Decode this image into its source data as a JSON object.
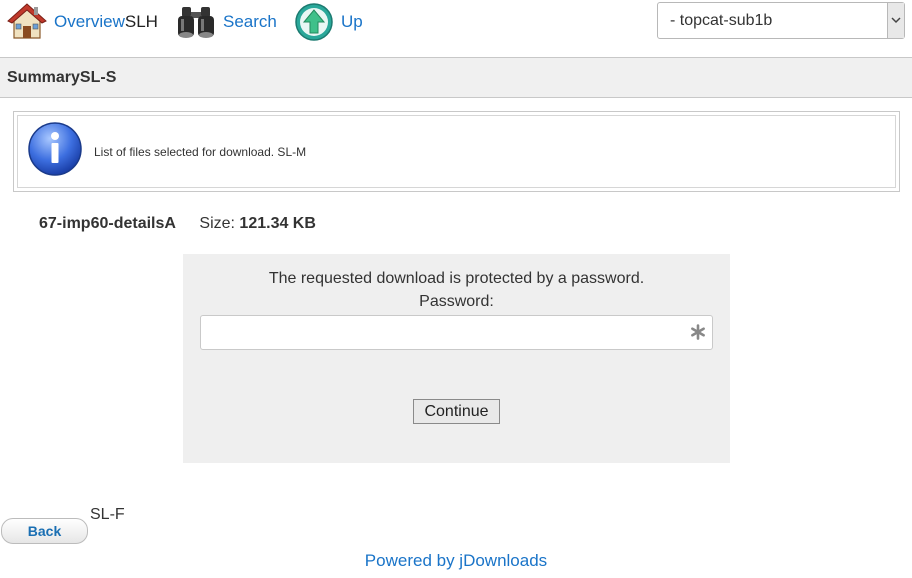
{
  "nav": {
    "overview_label": "Overview",
    "overview_suffix": "SLH",
    "search_label": "Search",
    "up_label": "Up"
  },
  "category_select": {
    "selected": "- topcat-sub1b"
  },
  "summary": {
    "title": "SummarySL-S"
  },
  "info": {
    "message": "List of files selected for download. SL-M"
  },
  "file": {
    "name": "67-imp60-detailsA",
    "size_label": "Size:",
    "size_value": "121.34 KB"
  },
  "password_form": {
    "message": "The requested download is protected by a password.",
    "label": "Password:",
    "value": "",
    "continue_label": "Continue"
  },
  "footer": {
    "back_label": "Back",
    "note": "SL-F",
    "powered_by": "Powered by jDownloads"
  },
  "icons": {
    "overview": "home-icon",
    "search": "binoculars-icon",
    "up": "up-arrow-icon",
    "info": "info-icon",
    "asterisk": "asterisk-icon"
  },
  "colors": {
    "link": "#1a74c8",
    "bar_bg": "#f0f0f0",
    "panel_bg": "#efefef"
  }
}
